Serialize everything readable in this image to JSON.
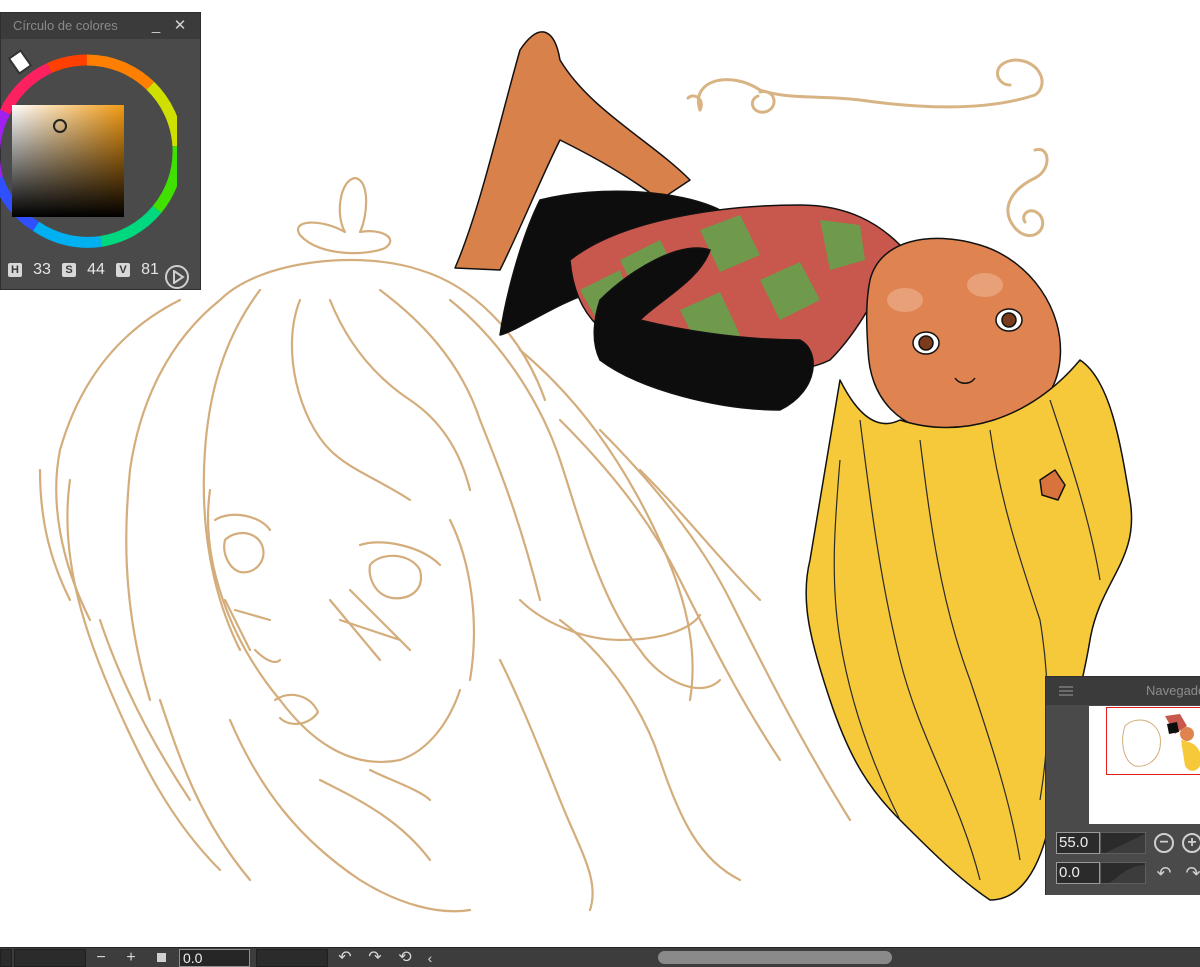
{
  "color_panel": {
    "title": "Círculo de colores",
    "minimize_glyph": "_",
    "close_glyph": "✕",
    "current_color": "#f0a030",
    "hsv": {
      "h_label": "H",
      "h_value": "33",
      "s_label": "S",
      "s_value": "44",
      "v_label": "V",
      "v_value": "81"
    }
  },
  "navigator": {
    "title": "Navegador",
    "zoom_value": "55.0",
    "rotation_value": "0.0",
    "zoom_out_glyph": "−",
    "zoom_in_glyph": "+"
  },
  "bottom_bar": {
    "minus_glyph": "−",
    "plus_glyph": "+",
    "value_field": "0.0",
    "undo_glyph": "↶",
    "redo_glyph": "↷",
    "reset_glyph": "⟲",
    "collapse_glyph": "‹"
  },
  "colors": {
    "panel_bg": "#4a4a4a",
    "titlebar_bg": "#3b3b3b",
    "sketch_line": "#d4ad7c",
    "hair_yellow": "#f6c93a",
    "skin": "#dd8250",
    "sweater_red": "#c8574d",
    "sweater_green": "#6f9a4c",
    "clothing_black": "#0d0d0d",
    "nav_frame_red": "#e02020"
  }
}
